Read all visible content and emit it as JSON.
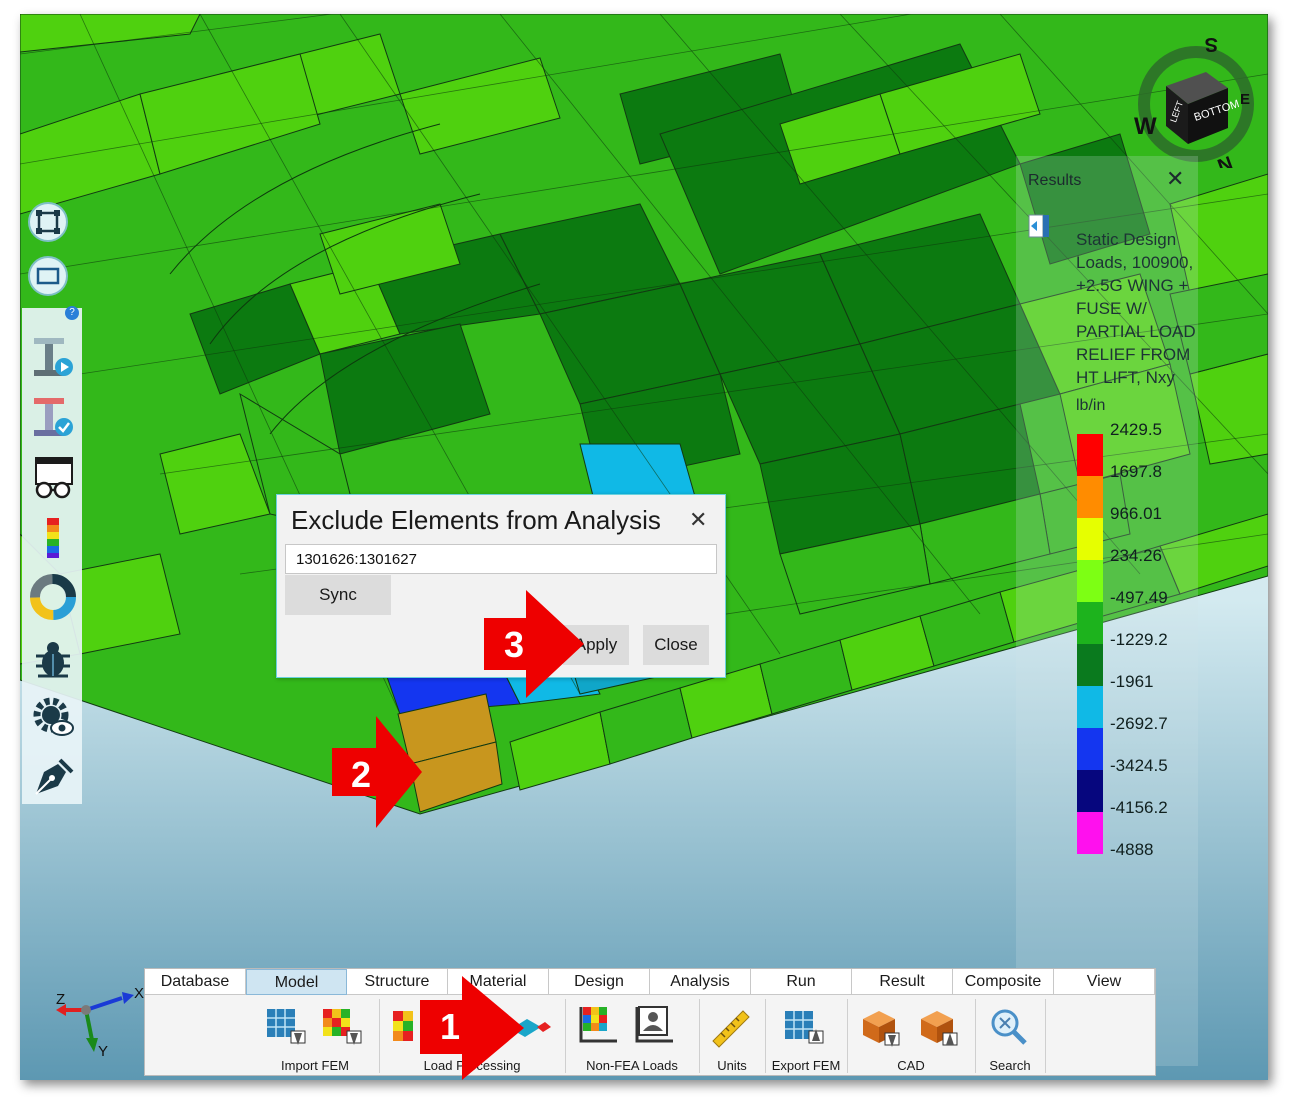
{
  "dialog": {
    "title": "Exclude Elements from Analysis",
    "input_value": "1301626:1301627",
    "sync_label": "Sync",
    "apply_label": "Apply",
    "close_label": "Close"
  },
  "results_panel": {
    "title": "Results",
    "description": "Static Design Loads, 100900, +2.5G WING + FUSE W/ PARTIAL LOAD RELIEF FROM HT LIFT, Nxy",
    "units": "lb/in",
    "legend": [
      {
        "value": "2429.5",
        "color": "#ff0000"
      },
      {
        "value": "1697.8",
        "color": "#ff8c00"
      },
      {
        "value": "966.01",
        "color": "#e6ff00"
      },
      {
        "value": "234.26",
        "color": "#7dff14"
      },
      {
        "value": "-497.49",
        "color": "#1db31d"
      },
      {
        "value": "-1229.2",
        "color": "#0a7a1e"
      },
      {
        "value": "-1961",
        "color": "#10b9e6"
      },
      {
        "value": "-2692.7",
        "color": "#1436f0"
      },
      {
        "value": "-3424.5",
        "color": "#06067e"
      },
      {
        "value": "-4156.2",
        "color": "#8410ff"
      },
      {
        "value": "-4888",
        "color": "#ff10ee"
      }
    ]
  },
  "callouts": [
    "1",
    "2",
    "3"
  ],
  "ribbon": {
    "tabs": [
      "Database",
      "Model",
      "Structure",
      "Material",
      "Design",
      "Analysis",
      "Run",
      "Result",
      "Composite",
      "View"
    ],
    "active_tab": "Model",
    "groups": [
      "Import FEM",
      "Load Processing",
      "Non-FEA Loads",
      "Units",
      "Export FEM",
      "CAD",
      "Search"
    ]
  },
  "axes": {
    "x": "X",
    "y": "Y",
    "z": "Z"
  },
  "viewcube": {
    "face_front": "BOTTOM",
    "face_side": "LEFT",
    "compass": [
      "S",
      "E",
      "N",
      "W"
    ]
  },
  "colors": {
    "accent": "#69d1de",
    "callout": "#ee0000",
    "mesh_light": "#4fd10f",
    "mesh_mid": "#33b81a",
    "mesh_dark": "#0c7a10"
  }
}
